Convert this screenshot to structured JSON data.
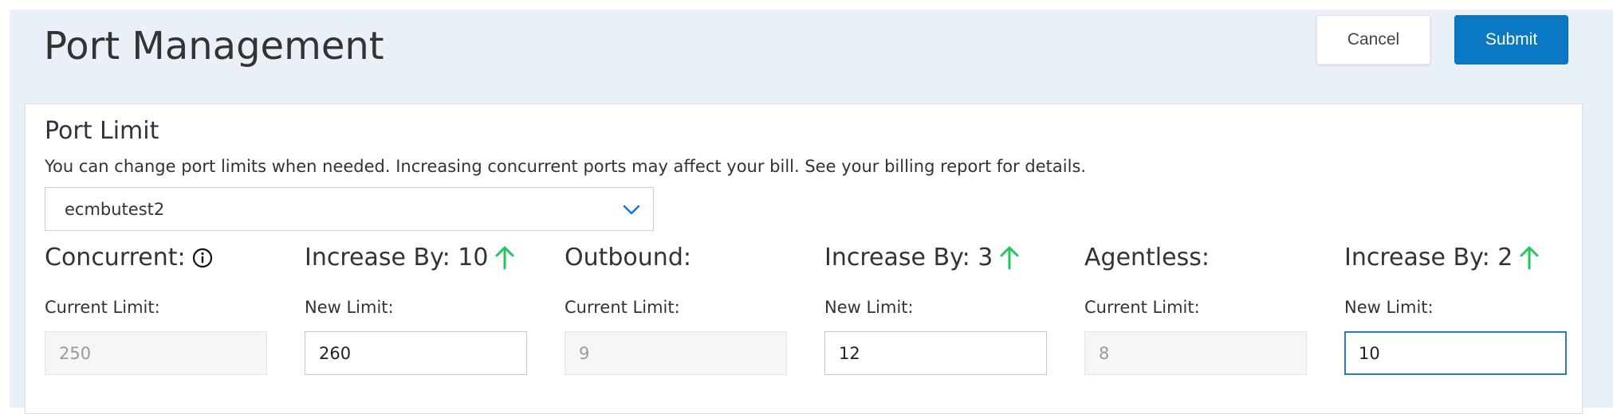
{
  "header": {
    "title": "Port Management",
    "cancel_label": "Cancel",
    "submit_label": "Submit"
  },
  "card": {
    "title": "Port Limit",
    "description": "You can change port limits when needed. Increasing concurrent ports may affect your bill. See your billing report for details.",
    "account_select": {
      "selected": "ecmbutest2"
    }
  },
  "limits": {
    "concurrent": {
      "heading": "Concurrent:",
      "current_label": "Current Limit:",
      "current_value": "250",
      "increase_heading": "Increase By: 10",
      "new_label": "New Limit:",
      "new_value": "260"
    },
    "outbound": {
      "heading": "Outbound:",
      "current_label": "Current Limit:",
      "current_value": "9",
      "increase_heading": "Increase By: 3",
      "new_label": "New Limit:",
      "new_value": "12"
    },
    "agentless": {
      "heading": "Agentless:",
      "current_label": "Current Limit:",
      "current_value": "8",
      "increase_heading": "Increase By: 2",
      "new_label": "New Limit:",
      "new_value": "10"
    }
  },
  "colors": {
    "accent": "#0a78c2",
    "increase_arrow": "#22c55e",
    "header_bg": "#eaf0f7"
  },
  "icons": {
    "info": "info-circle-icon",
    "increase": "arrow-up-icon",
    "dropdown": "chevron-down-icon"
  }
}
